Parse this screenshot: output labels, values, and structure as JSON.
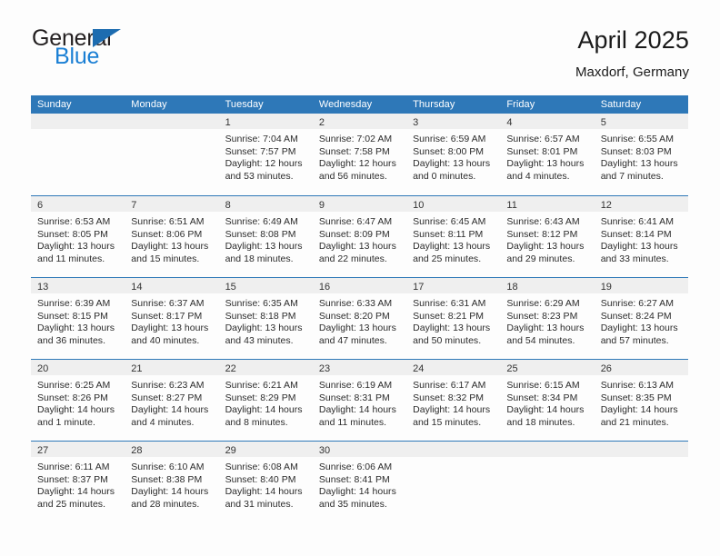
{
  "brand": {
    "word_one": "General",
    "word_two": "Blue",
    "triangle_icon": "triangle-logo-icon",
    "accent_color": "#1d6cb0"
  },
  "header": {
    "title": "April 2025",
    "subtitle": "Maxdorf, Germany"
  },
  "colors": {
    "header_blue": "#2e78b8",
    "day_band_gray": "#efefef",
    "text": "#2b2b2b"
  },
  "calendar": {
    "weekdays": [
      "Sunday",
      "Monday",
      "Tuesday",
      "Wednesday",
      "Thursday",
      "Friday",
      "Saturday"
    ],
    "weeks": [
      [
        {
          "day": "",
          "lines": []
        },
        {
          "day": "",
          "lines": []
        },
        {
          "day": "1",
          "lines": [
            "Sunrise: 7:04 AM",
            "Sunset: 7:57 PM",
            "Daylight: 12 hours",
            "and 53 minutes."
          ]
        },
        {
          "day": "2",
          "lines": [
            "Sunrise: 7:02 AM",
            "Sunset: 7:58 PM",
            "Daylight: 12 hours",
            "and 56 minutes."
          ]
        },
        {
          "day": "3",
          "lines": [
            "Sunrise: 6:59 AM",
            "Sunset: 8:00 PM",
            "Daylight: 13 hours",
            "and 0 minutes."
          ]
        },
        {
          "day": "4",
          "lines": [
            "Sunrise: 6:57 AM",
            "Sunset: 8:01 PM",
            "Daylight: 13 hours",
            "and 4 minutes."
          ]
        },
        {
          "day": "5",
          "lines": [
            "Sunrise: 6:55 AM",
            "Sunset: 8:03 PM",
            "Daylight: 13 hours",
            "and 7 minutes."
          ]
        }
      ],
      [
        {
          "day": "6",
          "lines": [
            "Sunrise: 6:53 AM",
            "Sunset: 8:05 PM",
            "Daylight: 13 hours",
            "and 11 minutes."
          ]
        },
        {
          "day": "7",
          "lines": [
            "Sunrise: 6:51 AM",
            "Sunset: 8:06 PM",
            "Daylight: 13 hours",
            "and 15 minutes."
          ]
        },
        {
          "day": "8",
          "lines": [
            "Sunrise: 6:49 AM",
            "Sunset: 8:08 PM",
            "Daylight: 13 hours",
            "and 18 minutes."
          ]
        },
        {
          "day": "9",
          "lines": [
            "Sunrise: 6:47 AM",
            "Sunset: 8:09 PM",
            "Daylight: 13 hours",
            "and 22 minutes."
          ]
        },
        {
          "day": "10",
          "lines": [
            "Sunrise: 6:45 AM",
            "Sunset: 8:11 PM",
            "Daylight: 13 hours",
            "and 25 minutes."
          ]
        },
        {
          "day": "11",
          "lines": [
            "Sunrise: 6:43 AM",
            "Sunset: 8:12 PM",
            "Daylight: 13 hours",
            "and 29 minutes."
          ]
        },
        {
          "day": "12",
          "lines": [
            "Sunrise: 6:41 AM",
            "Sunset: 8:14 PM",
            "Daylight: 13 hours",
            "and 33 minutes."
          ]
        }
      ],
      [
        {
          "day": "13",
          "lines": [
            "Sunrise: 6:39 AM",
            "Sunset: 8:15 PM",
            "Daylight: 13 hours",
            "and 36 minutes."
          ]
        },
        {
          "day": "14",
          "lines": [
            "Sunrise: 6:37 AM",
            "Sunset: 8:17 PM",
            "Daylight: 13 hours",
            "and 40 minutes."
          ]
        },
        {
          "day": "15",
          "lines": [
            "Sunrise: 6:35 AM",
            "Sunset: 8:18 PM",
            "Daylight: 13 hours",
            "and 43 minutes."
          ]
        },
        {
          "day": "16",
          "lines": [
            "Sunrise: 6:33 AM",
            "Sunset: 8:20 PM",
            "Daylight: 13 hours",
            "and 47 minutes."
          ]
        },
        {
          "day": "17",
          "lines": [
            "Sunrise: 6:31 AM",
            "Sunset: 8:21 PM",
            "Daylight: 13 hours",
            "and 50 minutes."
          ]
        },
        {
          "day": "18",
          "lines": [
            "Sunrise: 6:29 AM",
            "Sunset: 8:23 PM",
            "Daylight: 13 hours",
            "and 54 minutes."
          ]
        },
        {
          "day": "19",
          "lines": [
            "Sunrise: 6:27 AM",
            "Sunset: 8:24 PM",
            "Daylight: 13 hours",
            "and 57 minutes."
          ]
        }
      ],
      [
        {
          "day": "20",
          "lines": [
            "Sunrise: 6:25 AM",
            "Sunset: 8:26 PM",
            "Daylight: 14 hours",
            "and 1 minute."
          ]
        },
        {
          "day": "21",
          "lines": [
            "Sunrise: 6:23 AM",
            "Sunset: 8:27 PM",
            "Daylight: 14 hours",
            "and 4 minutes."
          ]
        },
        {
          "day": "22",
          "lines": [
            "Sunrise: 6:21 AM",
            "Sunset: 8:29 PM",
            "Daylight: 14 hours",
            "and 8 minutes."
          ]
        },
        {
          "day": "23",
          "lines": [
            "Sunrise: 6:19 AM",
            "Sunset: 8:31 PM",
            "Daylight: 14 hours",
            "and 11 minutes."
          ]
        },
        {
          "day": "24",
          "lines": [
            "Sunrise: 6:17 AM",
            "Sunset: 8:32 PM",
            "Daylight: 14 hours",
            "and 15 minutes."
          ]
        },
        {
          "day": "25",
          "lines": [
            "Sunrise: 6:15 AM",
            "Sunset: 8:34 PM",
            "Daylight: 14 hours",
            "and 18 minutes."
          ]
        },
        {
          "day": "26",
          "lines": [
            "Sunrise: 6:13 AM",
            "Sunset: 8:35 PM",
            "Daylight: 14 hours",
            "and 21 minutes."
          ]
        }
      ],
      [
        {
          "day": "27",
          "lines": [
            "Sunrise: 6:11 AM",
            "Sunset: 8:37 PM",
            "Daylight: 14 hours",
            "and 25 minutes."
          ]
        },
        {
          "day": "28",
          "lines": [
            "Sunrise: 6:10 AM",
            "Sunset: 8:38 PM",
            "Daylight: 14 hours",
            "and 28 minutes."
          ]
        },
        {
          "day": "29",
          "lines": [
            "Sunrise: 6:08 AM",
            "Sunset: 8:40 PM",
            "Daylight: 14 hours",
            "and 31 minutes."
          ]
        },
        {
          "day": "30",
          "lines": [
            "Sunrise: 6:06 AM",
            "Sunset: 8:41 PM",
            "Daylight: 14 hours",
            "and 35 minutes."
          ]
        },
        {
          "day": "",
          "lines": []
        },
        {
          "day": "",
          "lines": []
        },
        {
          "day": "",
          "lines": []
        }
      ]
    ]
  }
}
